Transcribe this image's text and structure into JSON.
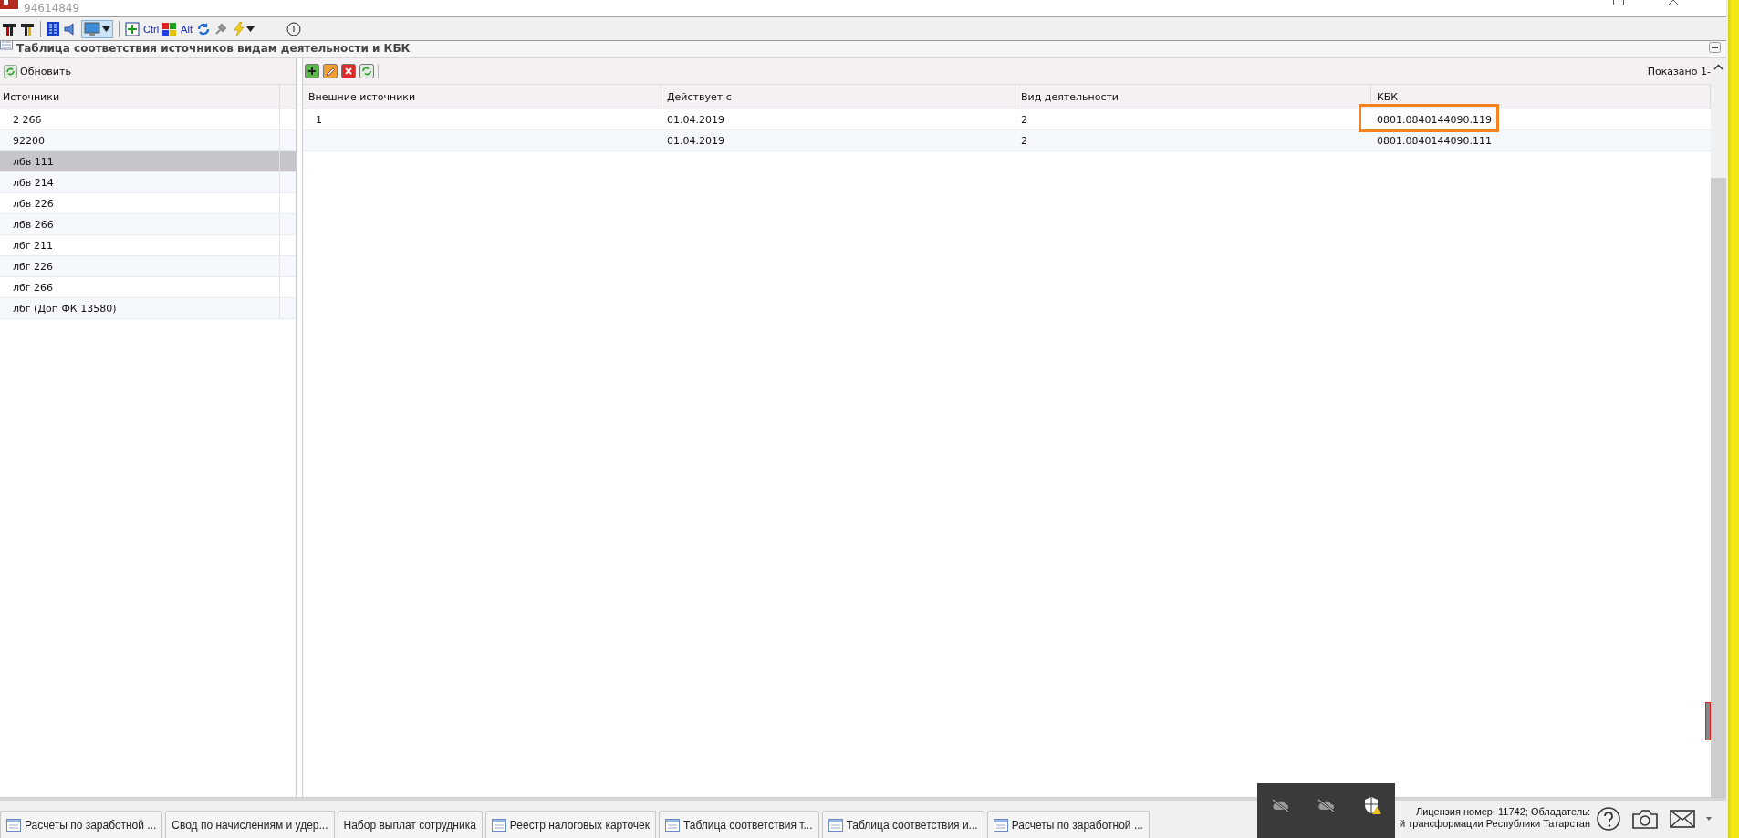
{
  "window": {
    "title": "94614849"
  },
  "toolbar": {
    "ctrl_label": "Ctrl",
    "alt_label": "Alt",
    "display_pressed": true
  },
  "panel": {
    "title": "Таблица соответствия источников видам деятельности и КБК"
  },
  "sources": {
    "refresh_label": "Обновить",
    "column": "Источники",
    "items": [
      {
        "label": "2 266",
        "selected": false
      },
      {
        "label": "92200",
        "selected": false
      },
      {
        "label": "лбв 111",
        "selected": true
      },
      {
        "label": "лбв 214",
        "selected": false
      },
      {
        "label": "лбв 226",
        "selected": false
      },
      {
        "label": "лбв 266",
        "selected": false
      },
      {
        "label": "лбг 211",
        "selected": false
      },
      {
        "label": "лбг 226",
        "selected": false
      },
      {
        "label": "лбг 266",
        "selected": false
      },
      {
        "label": "лбг (Доп ФК 13580)",
        "selected": false
      }
    ]
  },
  "table": {
    "shown": "Показано 1-",
    "columns": [
      "Внешние источники",
      "Действует с",
      "Вид деятельности",
      "КБК"
    ],
    "rows": [
      {
        "cells": [
          "1",
          "01.04.2019",
          "2",
          "0801.0840144090.119"
        ],
        "highlighted": true
      },
      {
        "cells": [
          "",
          "01.04.2019",
          "2",
          "0801.0840144090.111"
        ],
        "highlighted": false
      }
    ]
  },
  "taskbar": {
    "tabs": [
      {
        "label": "Расчеты по заработной ...",
        "has_icon": true
      },
      {
        "label": "Свод по начислениям и удер...",
        "has_icon": false
      },
      {
        "label": "Набор выплат сотрудника",
        "has_icon": false
      },
      {
        "label": "Реестр налоговых карточек",
        "has_icon": true
      },
      {
        "label": "Таблица соответствия т...",
        "has_icon": true
      },
      {
        "label": "Таблица соответствия и...",
        "has_icon": true
      },
      {
        "label": "Расчеты по заработной ...",
        "has_icon": true
      }
    ],
    "license_lines": [
      "Лицензия номер: 11742; Обладатель:",
      "й трансформации Республики Татарстан"
    ]
  }
}
